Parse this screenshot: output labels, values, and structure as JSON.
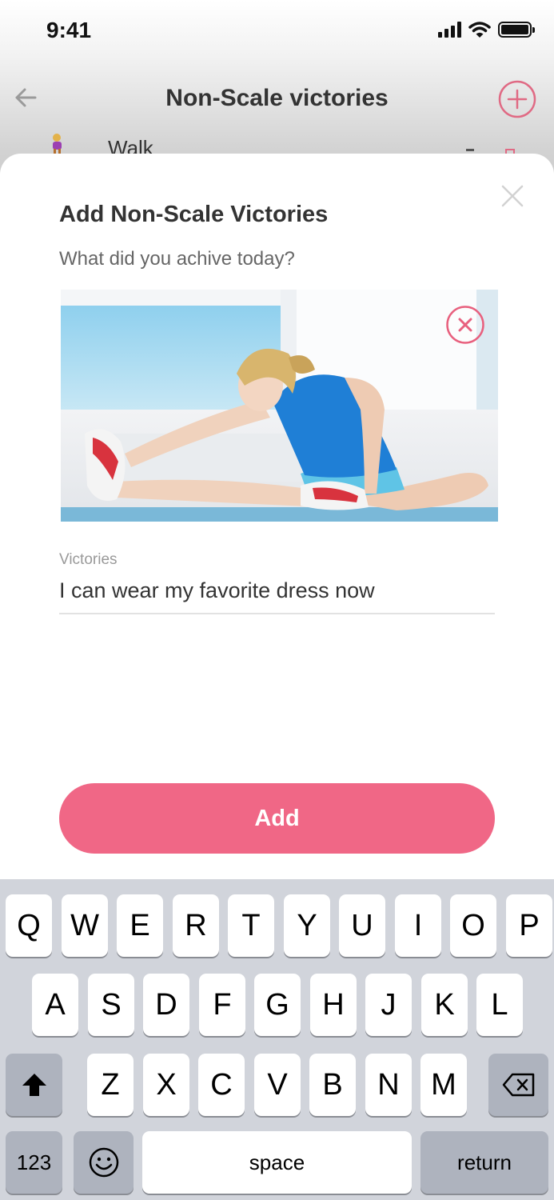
{
  "status_bar": {
    "time": "9:41"
  },
  "nav": {
    "title": "Non-Scale victories"
  },
  "background_list": {
    "item_label": "Walk"
  },
  "sheet": {
    "title": "Add Non-Scale Victories",
    "subtitle": "What did you achive today?",
    "field_label": "Victories",
    "field_value": "I can wear my favorite dress now",
    "add_button": "Add"
  },
  "keyboard": {
    "row1": [
      "Q",
      "W",
      "E",
      "R",
      "T",
      "Y",
      "U",
      "I",
      "O",
      "P"
    ],
    "row2": [
      "A",
      "S",
      "D",
      "F",
      "G",
      "H",
      "J",
      "K",
      "L"
    ],
    "row3": [
      "Z",
      "X",
      "C",
      "V",
      "B",
      "N",
      "M"
    ],
    "numbers_key": "123",
    "space_key": "space",
    "return_key": "return"
  },
  "colors": {
    "accent": "#f06786",
    "keyboard_bg": "#d1d4db"
  }
}
